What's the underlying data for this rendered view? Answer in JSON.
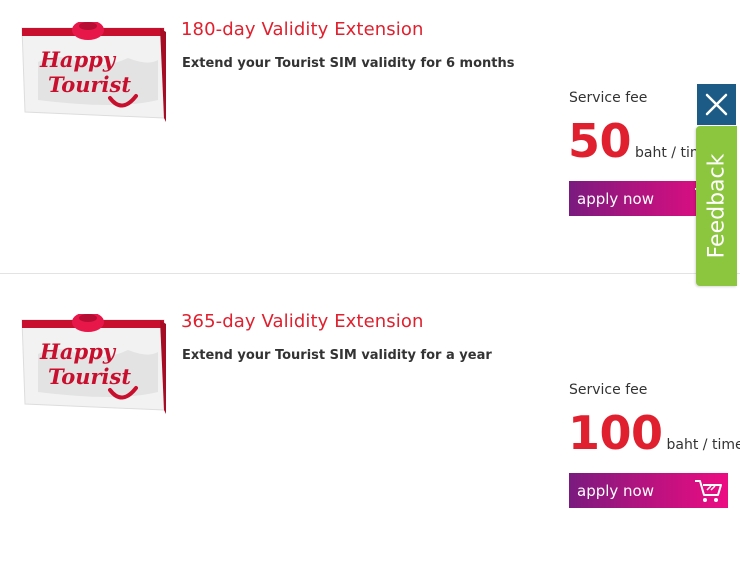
{
  "products": [
    {
      "image": {
        "lines": [
          "Happy",
          "Tourist"
        ],
        "icon": "happy-tourist-bag-icon"
      },
      "title": "180-day Validity Extension",
      "description": "Extend your Tourist SIM validity for 6 months",
      "fee_label": "Service fee",
      "price": "50",
      "unit": "baht / time",
      "apply_label": "apply now"
    },
    {
      "image": {
        "lines": [
          "Happy",
          "Tourist"
        ],
        "icon": "happy-tourist-bag-icon"
      },
      "title": "365-day Validity Extension",
      "description": "Extend your Tourist SIM validity for a year",
      "fee_label": "Service fee",
      "price": "100",
      "unit": "baht / time",
      "apply_label": "apply now"
    }
  ],
  "feedback": {
    "label": "Feedback",
    "close_icon": "close-icon"
  },
  "colors": {
    "accent_red": "#e0202e",
    "button_gradient_start": "#7a1a7f",
    "button_gradient_end": "#ec0c82",
    "feedback_green": "#8cc63f",
    "close_blue": "#1b5b86"
  }
}
